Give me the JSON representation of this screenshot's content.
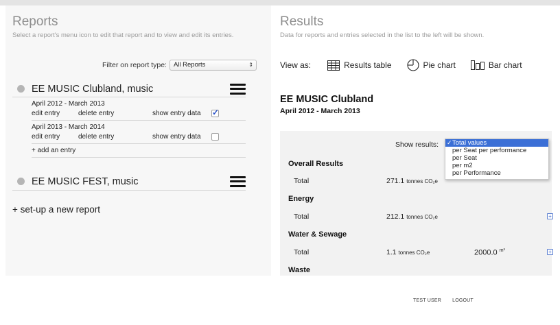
{
  "left": {
    "title": "Reports",
    "subtitle": "Select a report's menu icon to edit that report and to view and edit its entries.",
    "filter_label": "Filter on report type:",
    "filter_value": "All Reports",
    "reports": [
      {
        "name": "EE MUSIC Clubland, music",
        "entries": [
          {
            "period": "April 2012 - March 2013",
            "edit": "edit entry",
            "delete": "delete entry",
            "show": "show entry data",
            "checked": true
          },
          {
            "period": "April 2013 - March 2014",
            "edit": "edit entry",
            "delete": "delete entry",
            "show": "show entry data",
            "checked": false
          }
        ],
        "add_entry": "+ add an entry"
      },
      {
        "name": "EE MUSIC FEST, music"
      }
    ],
    "new_report": "+ set-up a new report"
  },
  "right": {
    "title": "Results",
    "subtitle": "Data for reports and entries selected in the list to the left will be shown.",
    "view_as": "View as:",
    "view_options": [
      "Results table",
      "Pie chart",
      "Bar chart"
    ],
    "report_title": "EE MUSIC Clubland",
    "report_period": "April 2012 - March 2013",
    "show_results_label": "Show results:",
    "show_results_options": [
      "Total values",
      "per Seat per performance",
      "per Seat",
      "per m2",
      "per Performance"
    ],
    "show_results_selected": "Total values",
    "sections": [
      {
        "name": "Overall Results",
        "row_label": "Total",
        "value": "271.1",
        "unit": "tonnes CO₂e"
      },
      {
        "name": "Energy",
        "row_label": "Total",
        "value": "212.1",
        "unit": "tonnes CO₂e"
      },
      {
        "name": "Water & Sewage",
        "row_label": "Total",
        "value": "1.1",
        "unit": "tonnes CO₂e",
        "value2": "2000.0",
        "unit2": "m³"
      },
      {
        "name": "Waste"
      }
    ]
  },
  "footer": {
    "user": "TEST USER",
    "logout": "LOGOUT"
  }
}
